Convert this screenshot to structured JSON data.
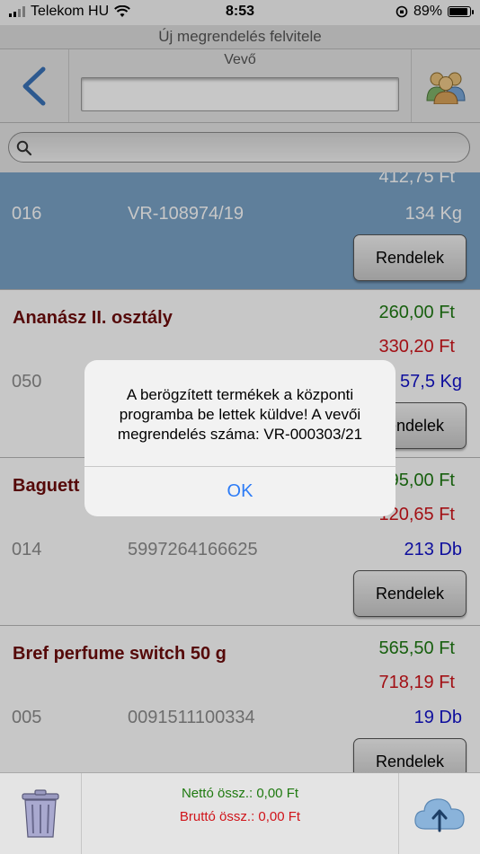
{
  "status": {
    "carrier": "Telekom HU",
    "time": "8:53",
    "battery": "89%",
    "battery_level": 0.89
  },
  "title": "Új megrendelés felvitele",
  "header": {
    "vevo_label": "Vevő",
    "vevo_value": ""
  },
  "search": {
    "placeholder": ""
  },
  "items": [
    {
      "price_top": "412,75 Ft",
      "code": "016",
      "barcode": "VR-108974/19",
      "qty": "134 Kg",
      "button": "Rendelek"
    },
    {
      "name": "Ananász II. osztály",
      "net": "260,00 Ft",
      "gross": "330,20 Ft",
      "code": "050",
      "barcode": "",
      "qty": "57,5 Kg",
      "button": "Rendelek"
    },
    {
      "name": "Baguett",
      "net": "95,00 Ft",
      "gross": "120,65 Ft",
      "code": "014",
      "barcode": "5997264166625",
      "qty": "213 Db",
      "button": "Rendelek"
    },
    {
      "name": "Bref perfume switch 50 g",
      "net": "565,50 Ft",
      "gross": "718,19 Ft",
      "code": "005",
      "barcode": "0091511100334",
      "qty": "19 Db",
      "button": "Rendelek"
    }
  ],
  "alert": {
    "message": "A berögzített termékek a központi programba be lettek küldve! A vevői megrendelés száma: VR-000303/21",
    "ok": "OK"
  },
  "footer": {
    "net_total": "Nettó össz.: 0,00 Ft",
    "gross_total": "Bruttó össz.: 0,00 Ft"
  },
  "icons": {
    "back": "chevron-left-icon",
    "customers": "people-icon",
    "search": "search-icon",
    "trash": "trash-icon",
    "upload": "cloud-upload-icon"
  },
  "colors": {
    "selected_row": "#7aa3c7",
    "net_price": "#1e7a12",
    "gross_price": "#d0141a",
    "quantity": "#1313c9",
    "product_name": "#6e0c0c",
    "alert_button": "#2d7cf6"
  }
}
